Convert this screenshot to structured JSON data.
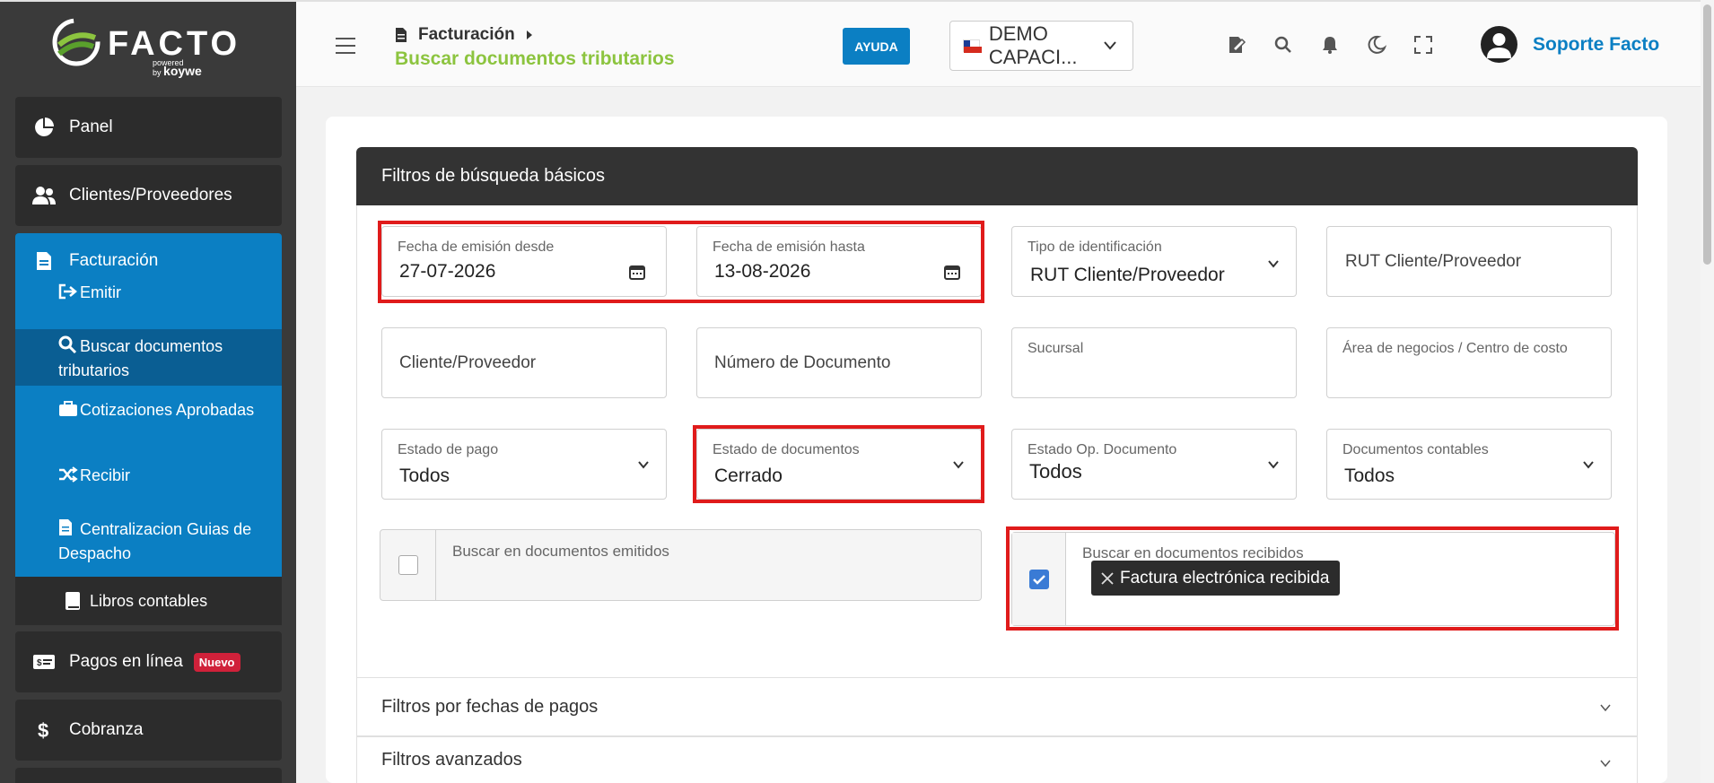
{
  "brand": {
    "name": "FACTO",
    "powered": "powered",
    "by": "by",
    "partner": "koywe"
  },
  "sidebar": {
    "items": [
      {
        "label": "Panel"
      },
      {
        "label": "Clientes/Proveedores"
      },
      {
        "label": "Facturación"
      },
      {
        "label": "Pagos en línea",
        "badge": "Nuevo"
      },
      {
        "label": "Cobranza"
      }
    ],
    "facturacion_sub": [
      {
        "label": "Emitir"
      },
      {
        "label": "Buscar documentos tributarios"
      },
      {
        "label": "Cotizaciones Aprobadas"
      },
      {
        "label": "Recibir"
      },
      {
        "label": "Centralizacion Guias de Despacho"
      }
    ],
    "libros": "Libros contables"
  },
  "header": {
    "breadcrumb": "Facturación",
    "page_title": "Buscar documentos tributarios",
    "help_label": "AYUDA",
    "company": "DEMO CAPACI...",
    "user_name": "Soporte Facto"
  },
  "filters": {
    "title": "Filtros de búsqueda básicos",
    "fecha_desde": {
      "label": "Fecha de emisión desde",
      "value": "27-07-2026"
    },
    "fecha_hasta": {
      "label": "Fecha de emisión hasta",
      "value": "13-08-2026"
    },
    "tipo_id": {
      "label": "Tipo de identificación",
      "value": "RUT Cliente/Proveedor"
    },
    "rut": {
      "placeholder": "RUT Cliente/Proveedor"
    },
    "cliente": {
      "placeholder": "Cliente/Proveedor"
    },
    "numero": {
      "placeholder": "Número de Documento"
    },
    "sucursal": {
      "label": "Sucursal"
    },
    "area": {
      "label": "Área de negocios / Centro de costo"
    },
    "estado_pago": {
      "label": "Estado de pago",
      "value": "Todos"
    },
    "estado_docs": {
      "label": "Estado de documentos",
      "value": "Cerrado"
    },
    "estado_op": {
      "label": "Estado Op. Documento",
      "value": "Todos"
    },
    "docs_contables": {
      "label": "Documentos contables",
      "value": "Todos"
    },
    "emitidos": {
      "label": "Buscar en documentos emitidos",
      "checked": false
    },
    "recibidos": {
      "label": "Buscar en documentos recibidos",
      "checked": true,
      "chip": "Factura electrónica recibida"
    }
  },
  "accordions": {
    "pagos": "Filtros por fechas de pagos",
    "avanzados": "Filtros avanzados"
  },
  "colors": {
    "primary": "#0b7fc3",
    "accent_green": "#8cc43f",
    "highlight": "#e01b1b",
    "sidebar": "#3a3a3a"
  }
}
